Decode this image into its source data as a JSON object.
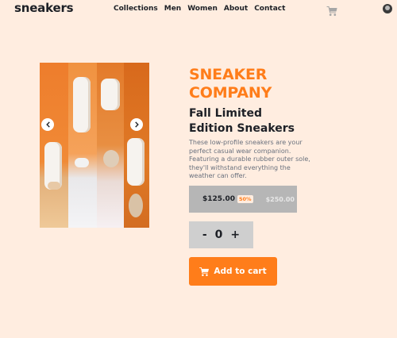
{
  "header": {
    "logo": "sneakers",
    "nav": [
      "Collections",
      "Men",
      "Women",
      "About",
      "Contact"
    ]
  },
  "product": {
    "company": "SNEAKER COMPANY",
    "title": "Fall Limited Edition Sneakers",
    "description": "These low-profile sneakers are your perfect casual wear companion. Featuring a durable rubber outer sole, they'll withstand everything the weather can offer.",
    "price": "$125.00",
    "discount": "50%",
    "original_price": "$250.00",
    "quantity": "0",
    "decrement": "-",
    "increment": "+",
    "add_to_cart": "Add to cart"
  },
  "icons": {
    "cart": "cart-icon",
    "avatar": "avatar",
    "prev": "chevron-left-icon",
    "next": "chevron-right-icon"
  },
  "colors": {
    "accent": "#ff7d1a",
    "background": "#ffede0",
    "text": "#1d2026",
    "muted": "#68707d"
  }
}
